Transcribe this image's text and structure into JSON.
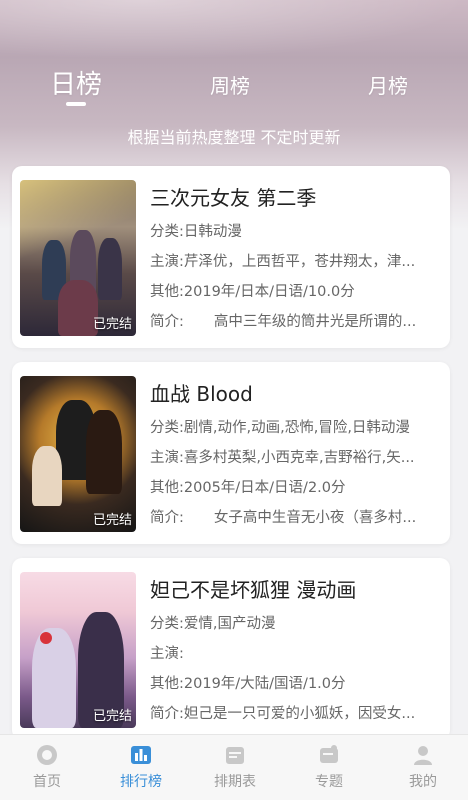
{
  "tabs": {
    "day": "日榜",
    "week": "周榜",
    "month": "月榜"
  },
  "subtitle": "根据当前热度整理 不定时更新",
  "items": [
    {
      "title": "三次元女友 第二季",
      "category_label": "分类:",
      "category": "日韩动漫",
      "cast_label": "主演:",
      "cast": "芹泽优，上西哲平，苍井翔太，津...",
      "other_label": "其他:",
      "other": "2019年/日本/日语/10.0分",
      "intro_label": "简介:",
      "intro": "高中三年级的筒井光是所谓的...",
      "badge": "已完结"
    },
    {
      "title": "血战 Blood",
      "category_label": "分类:",
      "category": "剧情,动作,动画,恐怖,冒险,日韩动漫",
      "cast_label": "主演:",
      "cast": "喜多村英梨,小西克幸,吉野裕行,矢...",
      "other_label": "其他:",
      "other": "2005年/日本/日语/2.0分",
      "intro_label": "简介:",
      "intro": "女子高中生音无小夜（喜多村...",
      "badge": "已完结"
    },
    {
      "title": "妲己不是坏狐狸 漫动画",
      "category_label": "分类:",
      "category": "爱情,国产动漫",
      "cast_label": "主演:",
      "cast": "",
      "other_label": "其他:",
      "other": "2019年/大陆/国语/1.0分",
      "intro_label": "简介:",
      "intro": "妲己是一只可爱的小狐妖，因受女...",
      "badge": "已完结"
    }
  ],
  "nav": {
    "home": "首页",
    "ranking": "排行榜",
    "schedule": "排期表",
    "topics": "专题",
    "mine": "我的"
  },
  "colors": {
    "active": "#3a8fd8",
    "inactive": "#9a9a9a"
  }
}
